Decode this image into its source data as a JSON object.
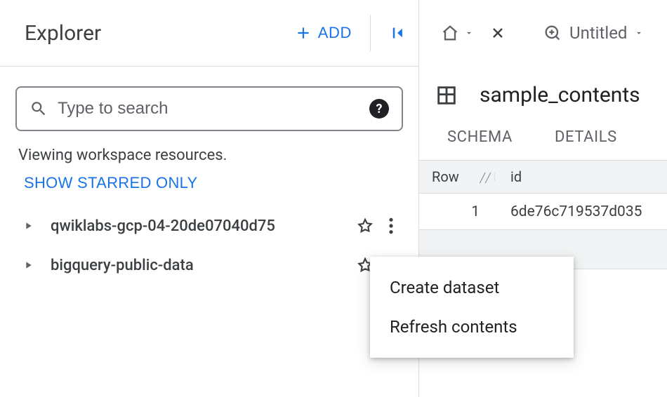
{
  "sidebar": {
    "title": "Explorer",
    "add_label": "ADD",
    "search_placeholder": "Type to search",
    "hint": "Viewing workspace resources.",
    "starred_label": "SHOW STARRED ONLY",
    "items": [
      {
        "label": "qwiklabs-gcp-04-20de07040d75"
      },
      {
        "label": "bigquery-public-data"
      }
    ]
  },
  "main": {
    "tab_label": "Untitled",
    "crumb_title": "sample_contents",
    "subtabs": [
      "SCHEMA",
      "DETAILS"
    ],
    "table": {
      "headers": {
        "row": "Row",
        "id": "id"
      },
      "rows": [
        {
          "row": "1",
          "id": "6de76c719537d035"
        }
      ]
    }
  },
  "context_menu": {
    "items": [
      "Create dataset",
      "Refresh contents"
    ]
  }
}
